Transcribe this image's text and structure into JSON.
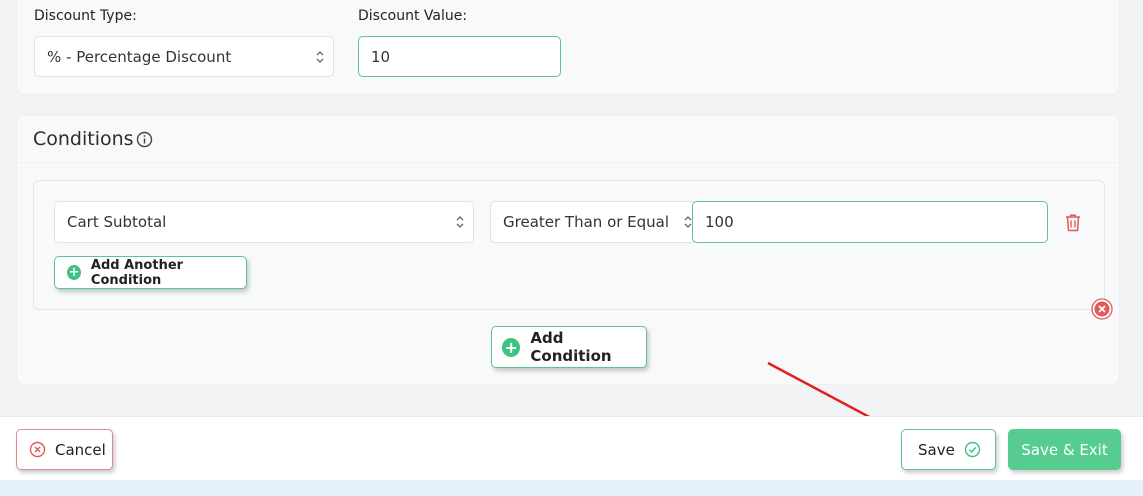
{
  "discount": {
    "type_label": "Discount Type:",
    "type_value": "% - Percentage Discount",
    "value_label": "Discount Value:",
    "value_value": "10"
  },
  "conditions": {
    "title": "Conditions",
    "rule": {
      "field": "Cart Subtotal",
      "operator": "Greater Than or Equal",
      "value": "100"
    },
    "add_another_label": "Add Another Condition",
    "add_condition_label": "Add Condition"
  },
  "footer": {
    "cancel_label": "Cancel",
    "save_label": "Save",
    "save_exit_label": "Save & Exit"
  },
  "colors": {
    "accent": "#3ec27f",
    "danger": "#e05a5a",
    "annotation_arrow": "#e02020"
  }
}
